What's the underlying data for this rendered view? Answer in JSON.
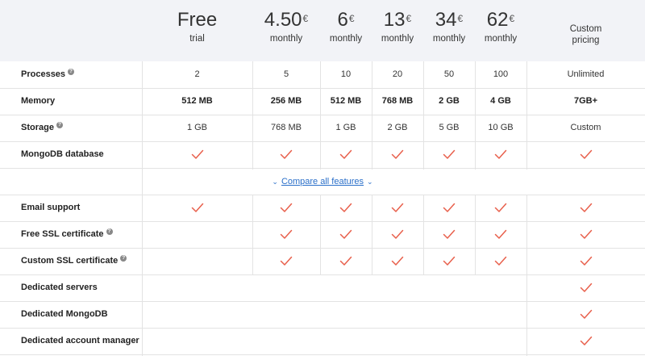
{
  "plans": [
    {
      "price": "Free",
      "currency": "",
      "period": "trial"
    },
    {
      "price": "4.50",
      "currency": "€",
      "period": "monthly"
    },
    {
      "price": "6",
      "currency": "€",
      "period": "monthly"
    },
    {
      "price": "13",
      "currency": "€",
      "period": "monthly"
    },
    {
      "price": "34",
      "currency": "€",
      "period": "monthly"
    },
    {
      "price": "62",
      "currency": "€",
      "period": "monthly"
    },
    {
      "price": "",
      "currency": "",
      "period_line1": "Custom",
      "period_line2": "pricing"
    }
  ],
  "rows": {
    "processes": {
      "label": "Processes",
      "values": [
        "2",
        "5",
        "10",
        "20",
        "50",
        "100",
        "Unlimited"
      ]
    },
    "memory": {
      "label": "Memory",
      "values": [
        "512 MB",
        "256 MB",
        "512 MB",
        "768 MB",
        "2 GB",
        "4 GB",
        "7GB+"
      ]
    },
    "storage": {
      "label": "Storage",
      "values": [
        "1 GB",
        "768 MB",
        "1 GB",
        "2 GB",
        "5 GB",
        "10 GB",
        "Custom"
      ]
    },
    "mongodb": {
      "label": "MongoDB database",
      "checks": [
        true,
        true,
        true,
        true,
        true,
        true,
        true
      ]
    },
    "email_support": {
      "label": "Email support",
      "checks": [
        true,
        true,
        true,
        true,
        true,
        true,
        true
      ]
    },
    "free_ssl": {
      "label": "Free SSL certificate",
      "checks": [
        false,
        true,
        true,
        true,
        true,
        true,
        true
      ]
    },
    "custom_ssl": {
      "label": "Custom SSL certificate",
      "checks": [
        false,
        true,
        true,
        true,
        true,
        true,
        true
      ]
    },
    "dedicated_servers": {
      "label": "Dedicated servers",
      "checks": [
        false,
        false,
        false,
        false,
        false,
        false,
        true
      ]
    },
    "dedicated_mongodb": {
      "label": "Dedicated MongoDB",
      "checks": [
        false,
        false,
        false,
        false,
        false,
        false,
        true
      ]
    },
    "account_manager": {
      "label": "Dedicated account manager",
      "checks": [
        false,
        false,
        false,
        false,
        false,
        false,
        true
      ]
    }
  },
  "compare_link": "Compare all features",
  "help_glyph": "?",
  "colors": {
    "check": "#e8604c",
    "link": "#2a6fc9",
    "header_bg": "#f2f3f7"
  }
}
